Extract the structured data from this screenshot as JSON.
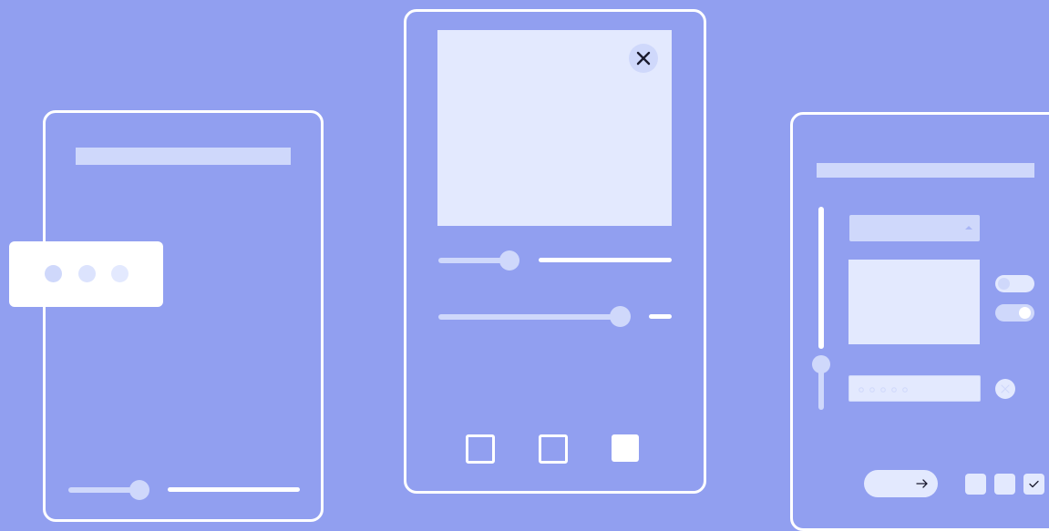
{
  "colors": {
    "background": "#919ff0",
    "card_border": "#ffffff",
    "placeholder_light": "#cfd8fb",
    "placeholder_pale": "#e3e9fe"
  },
  "left_card": {
    "popup": {
      "dots": [
        "dot",
        "dot",
        "dot"
      ]
    },
    "slider": {
      "value": 0.4
    }
  },
  "center_card": {
    "close_icon": "close-icon",
    "sliders": [
      {
        "value": 0.35
      },
      {
        "value": 0.86
      }
    ],
    "checkboxes": [
      {
        "checked": false
      },
      {
        "checked": false
      },
      {
        "checked": true
      }
    ]
  },
  "right_card": {
    "dropdown": {
      "icon": "caret-up-icon"
    },
    "toggles": [
      {
        "on": false
      },
      {
        "on": true
      }
    ],
    "vertical_slider": {
      "value": 0.25
    },
    "clear_icon": "clear-icon",
    "next_icon": "arrow-right-icon",
    "checkboxes": [
      {
        "checked": false
      },
      {
        "checked": false
      },
      {
        "checked": true,
        "icon": "check-icon"
      }
    ]
  }
}
